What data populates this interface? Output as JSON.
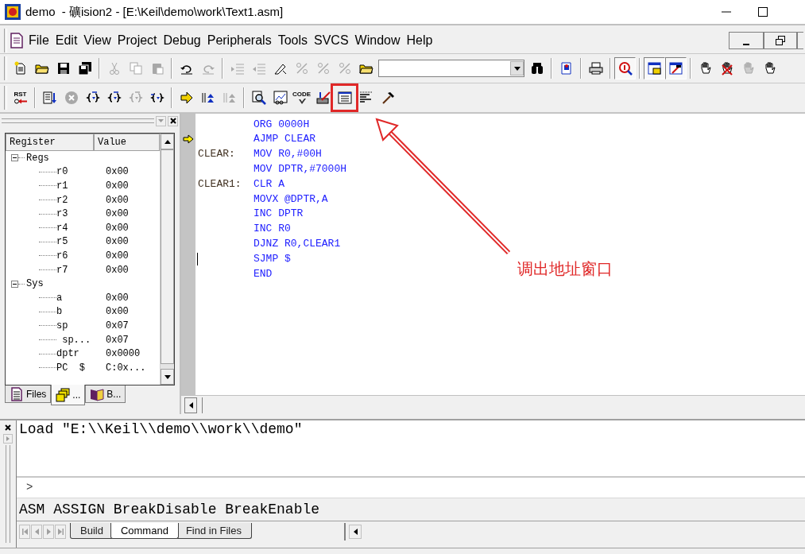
{
  "window": {
    "title": "demo  - 礦ision2 - [E:\\Keil\\demo\\work\\Text1.asm]"
  },
  "menu": [
    {
      "label": "File"
    },
    {
      "label": "Edit"
    },
    {
      "label": "View"
    },
    {
      "label": "Project"
    },
    {
      "label": "Debug"
    },
    {
      "label": "Peripherals"
    },
    {
      "label": "Tools"
    },
    {
      "label": "SVCS"
    },
    {
      "label": "Window"
    },
    {
      "label": "Help"
    }
  ],
  "toolbars": [
    {
      "groups": [
        [
          {
            "disabled": false,
            "pressed": false
          },
          {
            "disabled": false,
            "pressed": false
          },
          {
            "disabled": false,
            "pressed": false
          },
          {
            "disabled": false,
            "pressed": false
          }
        ],
        [
          {
            "disabled": true,
            "pressed": false
          },
          {
            "disabled": true,
            "pressed": false
          },
          {
            "disabled": true,
            "pressed": false
          }
        ],
        [
          {
            "disabled": false,
            "pressed": false
          },
          {
            "disabled": true,
            "pressed": false
          }
        ],
        [
          {
            "disabled": true,
            "pressed": false
          },
          {
            "disabled": true,
            "pressed": false
          },
          {
            "disabled": false,
            "pressed": false
          },
          {
            "disabled": true,
            "pressed": false
          },
          {
            "disabled": true,
            "pressed": false
          },
          {
            "disabled": true,
            "pressed": false
          },
          {
            "disabled": false,
            "pressed": false
          }
        ],
        [
          {
            "disabled": false,
            "pressed": false
          }
        ],
        [
          {
            "disabled": false,
            "pressed": false
          }
        ],
        [
          {
            "disabled": false,
            "pressed": false
          }
        ],
        [
          {
            "disabled": false,
            "pressed": true
          }
        ],
        [
          {
            "disabled": false,
            "pressed": true
          },
          {
            "disabled": false,
            "pressed": true
          }
        ],
        [
          {
            "disabled": false,
            "pressed": false
          },
          {
            "disabled": false,
            "pressed": false
          },
          {
            "disabled": true,
            "pressed": false
          },
          {
            "disabled": false,
            "pressed": false
          }
        ]
      ]
    },
    {
      "groups": [
        [
          {
            "disabled": false,
            "pressed": false,
            "label": "RST"
          }
        ],
        [
          {
            "disabled": false,
            "pressed": false
          },
          {
            "disabled": true,
            "pressed": false
          },
          {
            "disabled": false,
            "pressed": false
          },
          {
            "disabled": false,
            "pressed": false
          },
          {
            "disabled": true,
            "pressed": false
          },
          {
            "disabled": false,
            "pressed": false
          }
        ],
        [
          {
            "disabled": false,
            "pressed": false
          },
          {
            "disabled": false,
            "pressed": false
          },
          {
            "disabled": true,
            "pressed": false
          }
        ],
        [
          {
            "disabled": false,
            "pressed": false
          },
          {
            "disabled": false,
            "pressed": false
          },
          {
            "disabled": false,
            "pressed": false,
            "label": "CODE"
          },
          {
            "disabled": false,
            "pressed": false
          },
          {
            "disabled": false,
            "pressed": false,
            "highlighted": true
          },
          {
            "disabled": false,
            "pressed": false
          },
          {
            "disabled": false,
            "pressed": false
          }
        ]
      ]
    }
  ],
  "registers": {
    "columns": [
      "Register",
      "Value"
    ],
    "groups": [
      {
        "name": "Regs",
        "expanded": true,
        "children": [
          {
            "name": "r0",
            "value": "0x00"
          },
          {
            "name": "r1",
            "value": "0x00"
          },
          {
            "name": "r2",
            "value": "0x00"
          },
          {
            "name": "r3",
            "value": "0x00"
          },
          {
            "name": "r4",
            "value": "0x00"
          },
          {
            "name": "r5",
            "value": "0x00"
          },
          {
            "name": "r6",
            "value": "0x00"
          },
          {
            "name": "r7",
            "value": "0x00"
          }
        ]
      },
      {
        "name": "Sys",
        "expanded": true,
        "children": [
          {
            "name": "a",
            "value": "0x00"
          },
          {
            "name": "b",
            "value": "0x00"
          },
          {
            "name": "sp",
            "value": "0x07"
          },
          {
            "name": " sp...",
            "value": "0x07"
          },
          {
            "name": "dptr",
            "value": "0x0000"
          },
          {
            "name": "PC  $",
            "value": "C:0x..."
          }
        ]
      }
    ]
  },
  "panel_tabs": [
    {
      "label": "Files",
      "selected": false
    },
    {
      "label": "...",
      "selected": true
    },
    {
      "label": "B...",
      "selected": false
    }
  ],
  "editor": {
    "lines": [
      {
        "code": "ORG 0000H",
        "current": false,
        "cursor": false
      },
      {
        "code": "AJMP CLEAR",
        "current": true,
        "cursor": false
      },
      {
        "label": "CLEAR:",
        "code": "MOV R0,#00H",
        "current": false,
        "cursor": false
      },
      {
        "code": "MOV DPTR,#7000H",
        "current": false,
        "cursor": false
      },
      {
        "label": "CLEAR1:",
        "code": "CLR A",
        "current": false,
        "cursor": false
      },
      {
        "code": "MOVX @DPTR,A",
        "current": false,
        "cursor": false
      },
      {
        "code": "INC DPTR",
        "current": false,
        "cursor": false
      },
      {
        "code": "INC R0",
        "current": false,
        "cursor": false
      },
      {
        "code": "DJNZ R0,CLEAR1",
        "current": false,
        "cursor": false
      },
      {
        "code": "SJMP $",
        "current": false,
        "cursor": true
      },
      {
        "code": "END",
        "current": false,
        "cursor": false
      }
    ]
  },
  "annotation": {
    "text": "调出地址窗口"
  },
  "output": {
    "lines": [
      "Load \"E:\\\\Keil\\\\demo\\\\work\\\\demo\""
    ],
    "prompt": ">",
    "hint": "ASM ASSIGN BreakDisable BreakEnable",
    "tabs": [
      {
        "label": "Build",
        "selected": false
      },
      {
        "label": "Command",
        "selected": true
      },
      {
        "label": "Find in Files",
        "selected": false
      }
    ]
  }
}
